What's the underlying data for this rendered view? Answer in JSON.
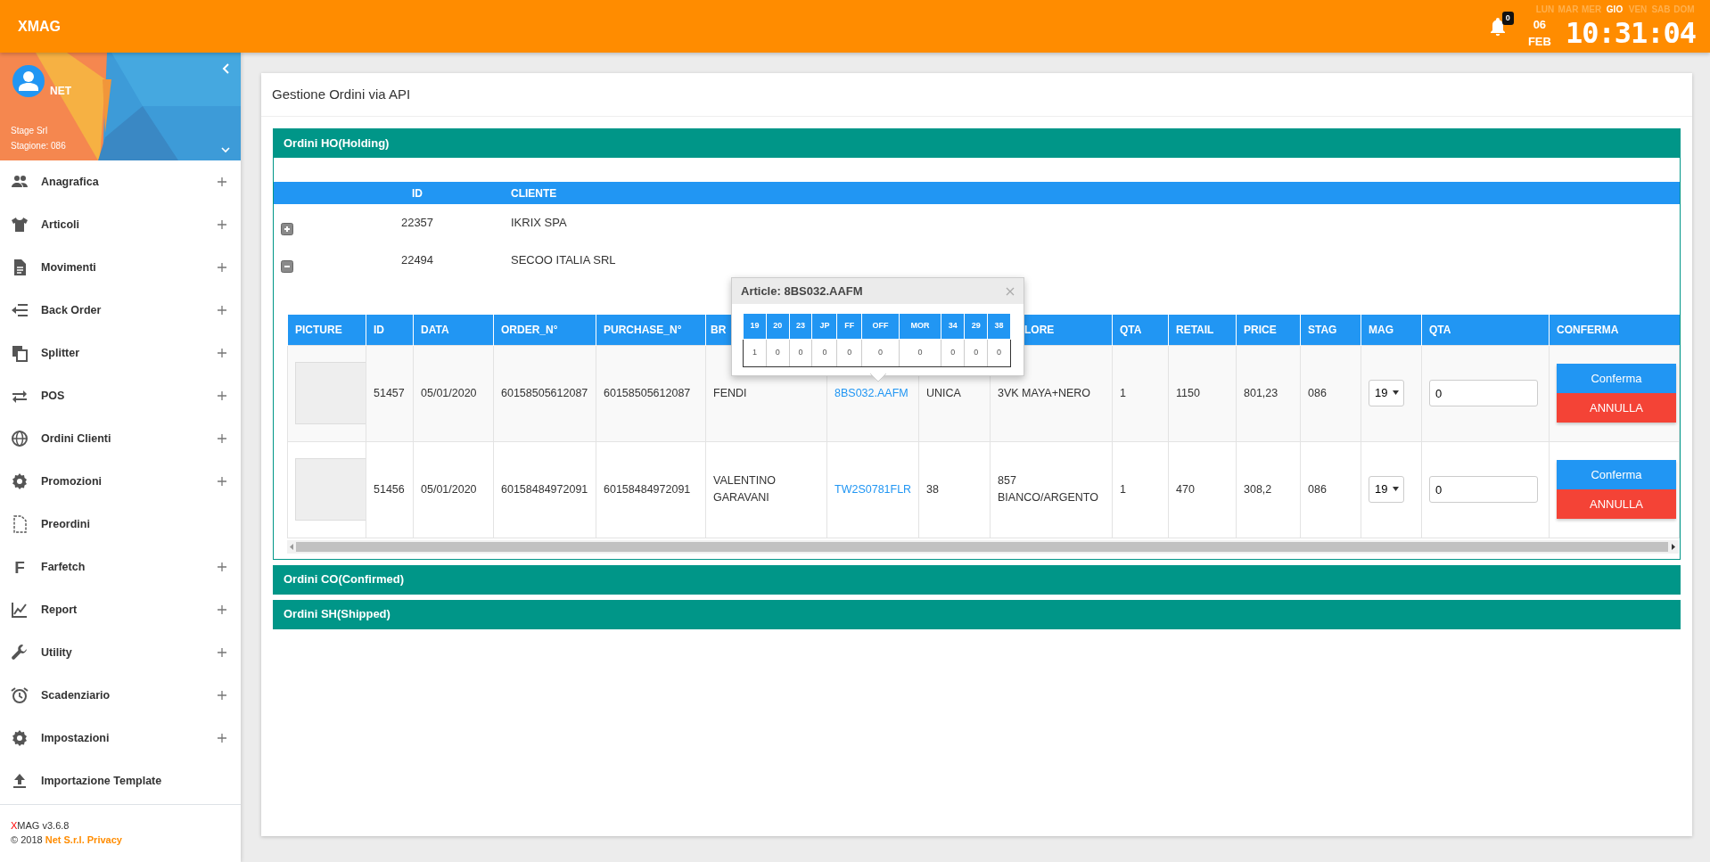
{
  "header": {
    "brand": "XMAG",
    "notifications": "0",
    "weekdays": [
      {
        "label": "LUN",
        "selected": false
      },
      {
        "label": "MAR",
        "selected": false
      },
      {
        "label": "MER",
        "selected": false
      },
      {
        "label": "GIO",
        "selected": true
      },
      {
        "label": "VEN",
        "selected": false
      },
      {
        "label": "SAB",
        "selected": false
      },
      {
        "label": "DOM",
        "selected": false
      }
    ],
    "day": "06",
    "month": "FEB",
    "clock": "10:31:04"
  },
  "sidebar": {
    "user": "NET",
    "company": "Stage Srl",
    "season": "Stagione: 086",
    "items": [
      {
        "label": "Anagrafica",
        "expandable": true
      },
      {
        "label": "Articoli",
        "expandable": true
      },
      {
        "label": "Movimenti",
        "expandable": true
      },
      {
        "label": "Back Order",
        "expandable": true
      },
      {
        "label": "Splitter",
        "expandable": true
      },
      {
        "label": "POS",
        "expandable": true
      },
      {
        "label": "Ordini Clienti",
        "expandable": true
      },
      {
        "label": "Promozioni",
        "expandable": true
      },
      {
        "label": "Preordini",
        "expandable": false
      },
      {
        "label": "Farfetch",
        "expandable": true,
        "glyph": "F"
      },
      {
        "label": "Report",
        "expandable": true
      },
      {
        "label": "Utility",
        "expandable": true
      },
      {
        "label": "Scadenziario",
        "expandable": true
      },
      {
        "label": "Impostazioni",
        "expandable": true
      },
      {
        "label": "Importazione Template",
        "expandable": false
      }
    ],
    "footer": {
      "brand_initial": "X",
      "version": "MAG v3.6.8",
      "copyright": "© 2018",
      "link": "Net S.r.l. Privacy"
    }
  },
  "page": {
    "title": "Gestione Ordini via API",
    "sections": [
      {
        "title": "Ordini HO(Holding)",
        "expanded": true,
        "order_columns": [
          "ID",
          "CLIENTE"
        ],
        "orders": [
          {
            "id": "22357",
            "client": "IKRIX SPA",
            "expanded": false
          },
          {
            "id": "22494",
            "client": "SECOO ITALIA SRL",
            "expanded": true,
            "detail": {
              "columns": [
                {
                  "label": "PICTURE"
                },
                {
                  "label": "ID"
                },
                {
                  "label": "DATA"
                },
                {
                  "label": "ORDER_N°"
                },
                {
                  "label": "PURCHASE_N°"
                },
                {
                  "label": "BR"
                },
                {},
                {},
                {
                  "label": "LORE"
                },
                {
                  "label": "QTA"
                },
                {
                  "label": "RETAIL"
                },
                {
                  "label": "PRICE"
                },
                {
                  "label": "STAG"
                },
                {
                  "label": "MAG"
                },
                {
                  "label": "QTA"
                },
                {
                  "label": "CONFERMA"
                }
              ],
              "rows": [
                {
                  "picture": true,
                  "id": "51457",
                  "date": "05/01/2020",
                  "order_no": "60158505612087",
                  "purchase_no": "60158505612087",
                  "brand": "FENDI",
                  "article": "8BS032.AAFM",
                  "size": "UNICA",
                  "color_name": "3VK MAYA+NERO",
                  "qty": "1",
                  "retail": "1150",
                  "price": "801,23",
                  "season": "086",
                  "warehouse": "19",
                  "qty_input": "0",
                  "actions": [
                    {
                      "label": "Conferma",
                      "kind": "confirm"
                    },
                    {
                      "label": "ANNULLA",
                      "kind": "cancel"
                    }
                  ]
                },
                {
                  "picture": true,
                  "id": "51456",
                  "date": "05/01/2020",
                  "order_no": "60158484972091",
                  "purchase_no": "60158484972091",
                  "brand": "VALENTINO GARAVANI",
                  "article": "TW2S0781FLR",
                  "size": "38",
                  "color_name": "857 BIANCO/ARGENTO",
                  "qty": "1",
                  "retail": "470",
                  "price": "308,2",
                  "season": "086",
                  "warehouse": "19",
                  "qty_input": "0",
                  "actions": [
                    {
                      "label": "Conferma",
                      "kind": "confirm"
                    },
                    {
                      "label": "ANNULLA",
                      "kind": "cancel"
                    }
                  ]
                }
              ],
              "popover": {
                "title": "Article: 8BS032.AAFM",
                "sizes": [
                  {
                    "size": "19",
                    "qty": "1"
                  },
                  {
                    "size": "20",
                    "qty": "0"
                  },
                  {
                    "size": "23",
                    "qty": "0"
                  },
                  {
                    "size": "JP",
                    "qty": "0"
                  },
                  {
                    "size": "FF",
                    "qty": "0"
                  },
                  {
                    "size": "OFF",
                    "qty": "0"
                  },
                  {
                    "size": "MOR",
                    "qty": "0"
                  },
                  {
                    "size": "34",
                    "qty": "0"
                  },
                  {
                    "size": "29",
                    "qty": "0"
                  },
                  {
                    "size": "38",
                    "qty": "0"
                  }
                ]
              }
            }
          }
        ]
      },
      {
        "title": "Ordini CO(Confirmed)",
        "expanded": false
      },
      {
        "title": "Ordini SH(Shipped)",
        "expanded": false
      }
    ]
  }
}
